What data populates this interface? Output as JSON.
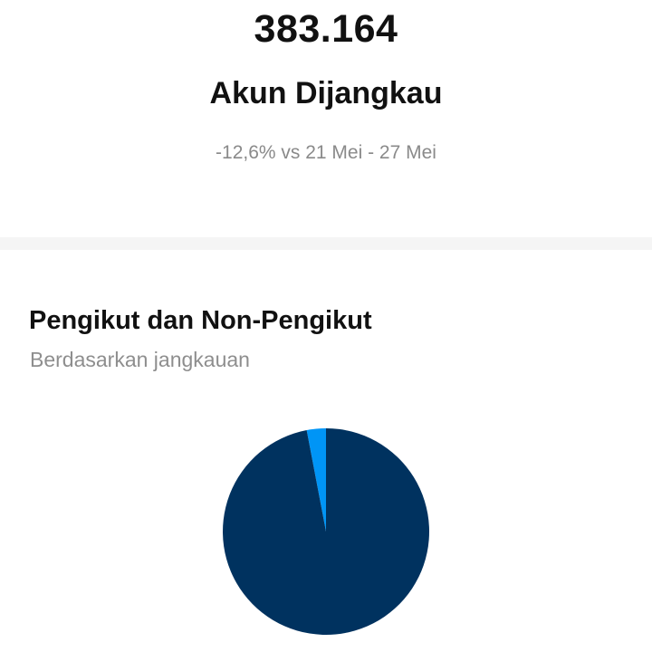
{
  "summary": {
    "value": "383.164",
    "label": "Akun Dijangkau",
    "comparison": "-12,6% vs 21 Mei - 27 Mei"
  },
  "section": {
    "title": "Pengikut dan Non-Pengikut",
    "subtitle": "Berdasarkan jangkauan"
  },
  "colors": {
    "followers": "#00325f",
    "non_followers": "#0095f6"
  },
  "chart_data": {
    "type": "pie",
    "slices": [
      {
        "share": 0.03,
        "color": "#0095f6"
      },
      {
        "share": 0.97,
        "color": "#00325f"
      }
    ]
  }
}
